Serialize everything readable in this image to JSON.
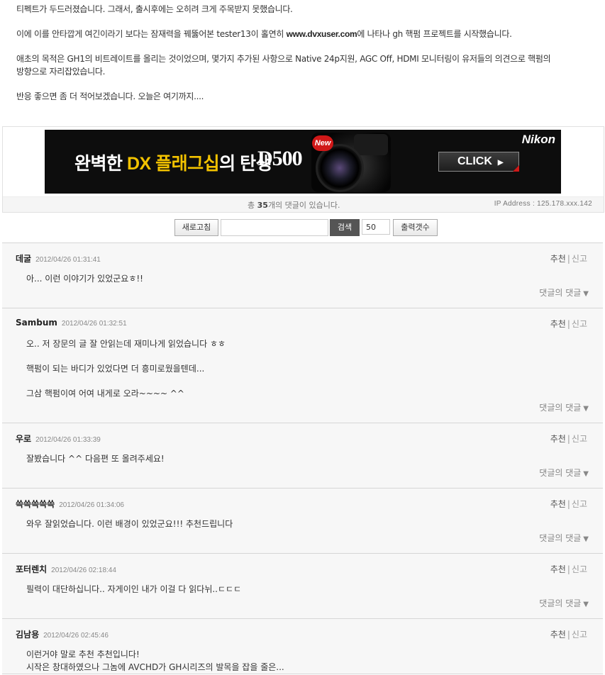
{
  "article": {
    "lines": [
      "티펙트가 두드러졌습니다. 그래서, 출시후에는 오히려 크게 주목받지 못했습니다.",
      "",
      {
        "pre": "이에 이를 안타깝게 여긴이라기 보다는 잠재력을 꿰뚫어본 tester13이 홀연히 ",
        "link": "www.dvxuser.com",
        "post": "에 나타나 gh 핵펌 프로젝트를 시작했습니다."
      },
      "",
      "애초의 목적은 GH1의 비트레이트를 올리는 것이었으며, 몇가지 추가된 사항으로 Native 24p지원, AGC Off, HDMI 모니터링이 유저들의 의견으로 핵펌의",
      "방향으로 자리잡았습니다.",
      "",
      "반응 좋으면 좀 더 적어보겠습니다. 오늘은 여기까지...."
    ]
  },
  "banner": {
    "title_pre": "완벽한 ",
    "title_hl": "DX 플래그십",
    "title_post": "의 탄생",
    "model": "D500",
    "badge": "New",
    "brand": "Nikon",
    "cta": "CLICK",
    "colors": {
      "highlight": "#f2c200",
      "badge": "#d01818"
    }
  },
  "count": {
    "pre": "총 ",
    "num": "35",
    "post": "개의 댓글이 있습니다.",
    "ip": "IP Address : 125.178.xxx.142"
  },
  "toolbar": {
    "refresh": "새로고침",
    "search_value": "",
    "search": "검색",
    "output_count": "50",
    "output_btn": "출력갯수"
  },
  "comment_labels": {
    "recommend": "추천",
    "report": "신고",
    "reply": "댓글의 댓글"
  },
  "comments": [
    {
      "author": "데굴",
      "date": "2012/04/26 01:31:41",
      "lines": [
        "아... 이런 이야기가 있었군요ㅎ!!"
      ]
    },
    {
      "author": "Sambum",
      "date": "2012/04/26 01:32:51",
      "lines": [
        "오.. 저 장문의 글 잘 안읽는데 재미나게 읽었습니다 ㅎㅎ",
        "",
        "핵펌이 되는 바디가 있었다면 더 흥미로웠을텐데...",
        "",
        "그삼 핵펌이여 어여 내게로 오라~~~~ ^^"
      ]
    },
    {
      "author": "우로",
      "date": "2012/04/26 01:33:39",
      "lines": [
        "잘봤습니다 ^^ 다음편 또 올려주세요!"
      ]
    },
    {
      "author": "쓱쓱쓱쓱쓱",
      "date": "2012/04/26 01:34:06",
      "lines": [
        "와우 잘읽었습니다. 이런 배경이 있었군요!!! 추천드립니다"
      ]
    },
    {
      "author": "포터렌치",
      "date": "2012/04/26 02:18:44",
      "lines": [
        "필력이 대단하십니다.. 자게이인 내가 이걸 다 읽다뉘..ㄷㄷㄷ"
      ]
    },
    {
      "author": "김남용",
      "date": "2012/04/26 02:45:46",
      "lines": [
        "이런거야 말로 추천 추천입니다!",
        "시작은 창대하였으나 그놈에 AVCHD가 GH시리즈의 발목을 잡을 줄은..."
      ]
    }
  ]
}
